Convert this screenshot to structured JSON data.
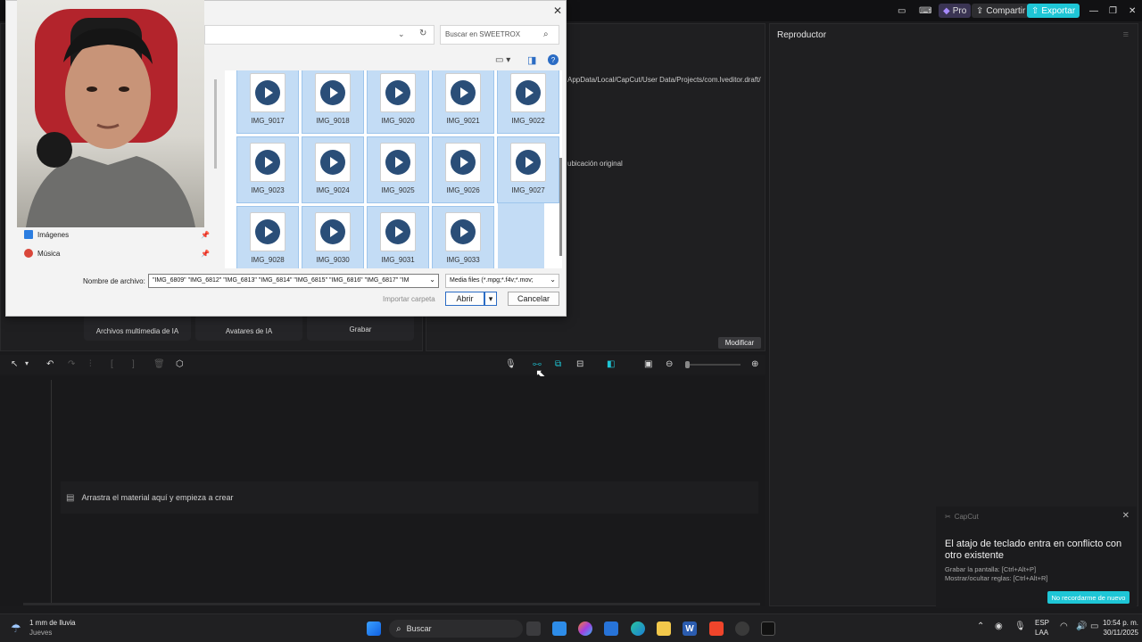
{
  "topbar": {
    "pro_label": "Pro",
    "share_label": "Compartir",
    "export_label": "Exportar"
  },
  "player": {
    "title": "Reproductor"
  },
  "properties": {
    "path_text": "AppData/Local/CapCut/User Data/Projects/com.lveditor.draft/",
    "location_text": "ubicación original",
    "modify_label": "Modificar"
  },
  "media_panel": {
    "ai_media_label": "Archivos multimedia de IA",
    "ai_avatars_label": "Avatares de IA",
    "record_label": "Grabar"
  },
  "timeline": {
    "drop_hint": "Arrastra el material aquí y empieza a crear"
  },
  "dialog": {
    "search_placeholder": "Buscar en SWEETROX",
    "sidebar": [
      {
        "label": "Imágenes"
      },
      {
        "label": "Música"
      }
    ],
    "files": [
      "IMG_9017",
      "IMG_9018",
      "IMG_9020",
      "IMG_9021",
      "IMG_9022",
      "IMG_9023",
      "IMG_9024",
      "IMG_9025",
      "IMG_9026",
      "IMG_9027",
      "IMG_9028",
      "IMG_9030",
      "IMG_9031",
      "IMG_9033"
    ],
    "filename_label": "Nombre de archivo:",
    "filename_value": "\"IMG_6809\" \"IMG_6812\" \"IMG_6813\" \"IMG_6814\" \"IMG_6815\" \"IMG_6816\" \"IMG_6817\" \"IM",
    "filetype_value": "Media files (*.mpg;*.f4v;*.mov;",
    "import_folder_label": "Importar carpeta",
    "open_label": "Abrir",
    "cancel_label": "Cancelar"
  },
  "notification": {
    "app_name": "CapCut",
    "title": "El atajo de teclado entra en conflicto con otro existente",
    "line1": "Grabar la pantalla: [Ctrl+Alt+P]",
    "line2": "Mostrar/ocultar reglas: [Ctrl+Alt+R]",
    "button_label": "No recordarme de nuevo"
  },
  "taskbar": {
    "weather_text": "1 mm de lluvia",
    "weather_day": "Jueves",
    "search_label": "Buscar",
    "lang_top": "ESP",
    "lang_bottom": "LAA",
    "time": "10:54 p. m.",
    "date": "30/11/2025"
  },
  "colors": {
    "accent": "#1ec6d6",
    "pro": "#6a54d6",
    "selection": "#c3dcf5"
  }
}
